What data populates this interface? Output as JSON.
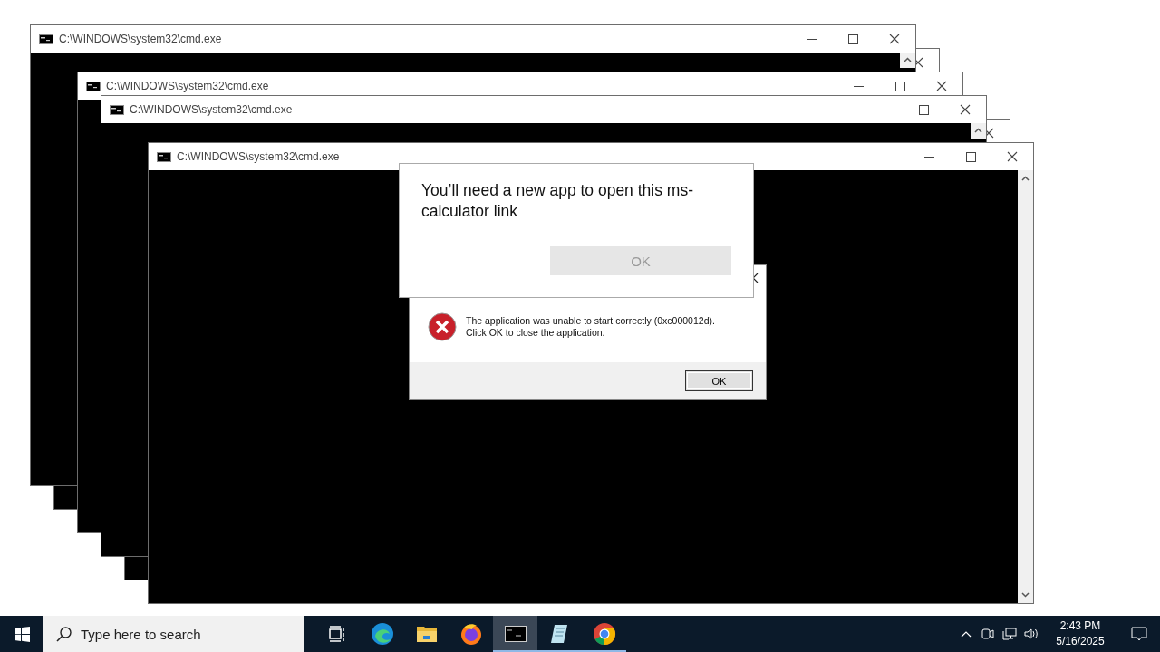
{
  "windows": [
    {
      "kind": "covered"
    },
    {
      "kind": "titled",
      "title": "C:\\WINDOWS\\system32\\cmd.exe"
    },
    {
      "kind": "covered"
    },
    {
      "kind": "titled",
      "title": "C:\\WINDOWS\\system32\\cmd.exe"
    },
    {
      "kind": "titled",
      "title": "C:\\WINDOWS\\system32\\cmd.exe"
    },
    {
      "kind": "titled",
      "title": "C:\\WINDOWS\\system32\\cmd.exe"
    }
  ],
  "error_dialog": {
    "message_lines": [
      "The application was unable to start correctly (0xc000012d).",
      "Click OK to close the application."
    ],
    "button": "OK"
  },
  "app_dialog": {
    "message": "You’ll need a new app to open this ms-calculator link",
    "button": "OK",
    "button_disabled": true
  },
  "taskbar": {
    "search": {
      "placeholder": "Type here to search"
    },
    "apps": [
      {
        "kind": "taskview",
        "running": false,
        "selected": false
      },
      {
        "kind": "edge",
        "running": false,
        "selected": false
      },
      {
        "kind": "explorer",
        "running": false,
        "selected": false
      },
      {
        "kind": "firefox",
        "running": false,
        "selected": false
      },
      {
        "kind": "cmd",
        "running": true,
        "selected": true
      },
      {
        "kind": "notepad",
        "running": true,
        "selected": false
      },
      {
        "kind": "chrome",
        "running": true,
        "selected": false
      }
    ],
    "clock": {
      "time": "2:43 PM",
      "date": "5/16/2025"
    }
  }
}
